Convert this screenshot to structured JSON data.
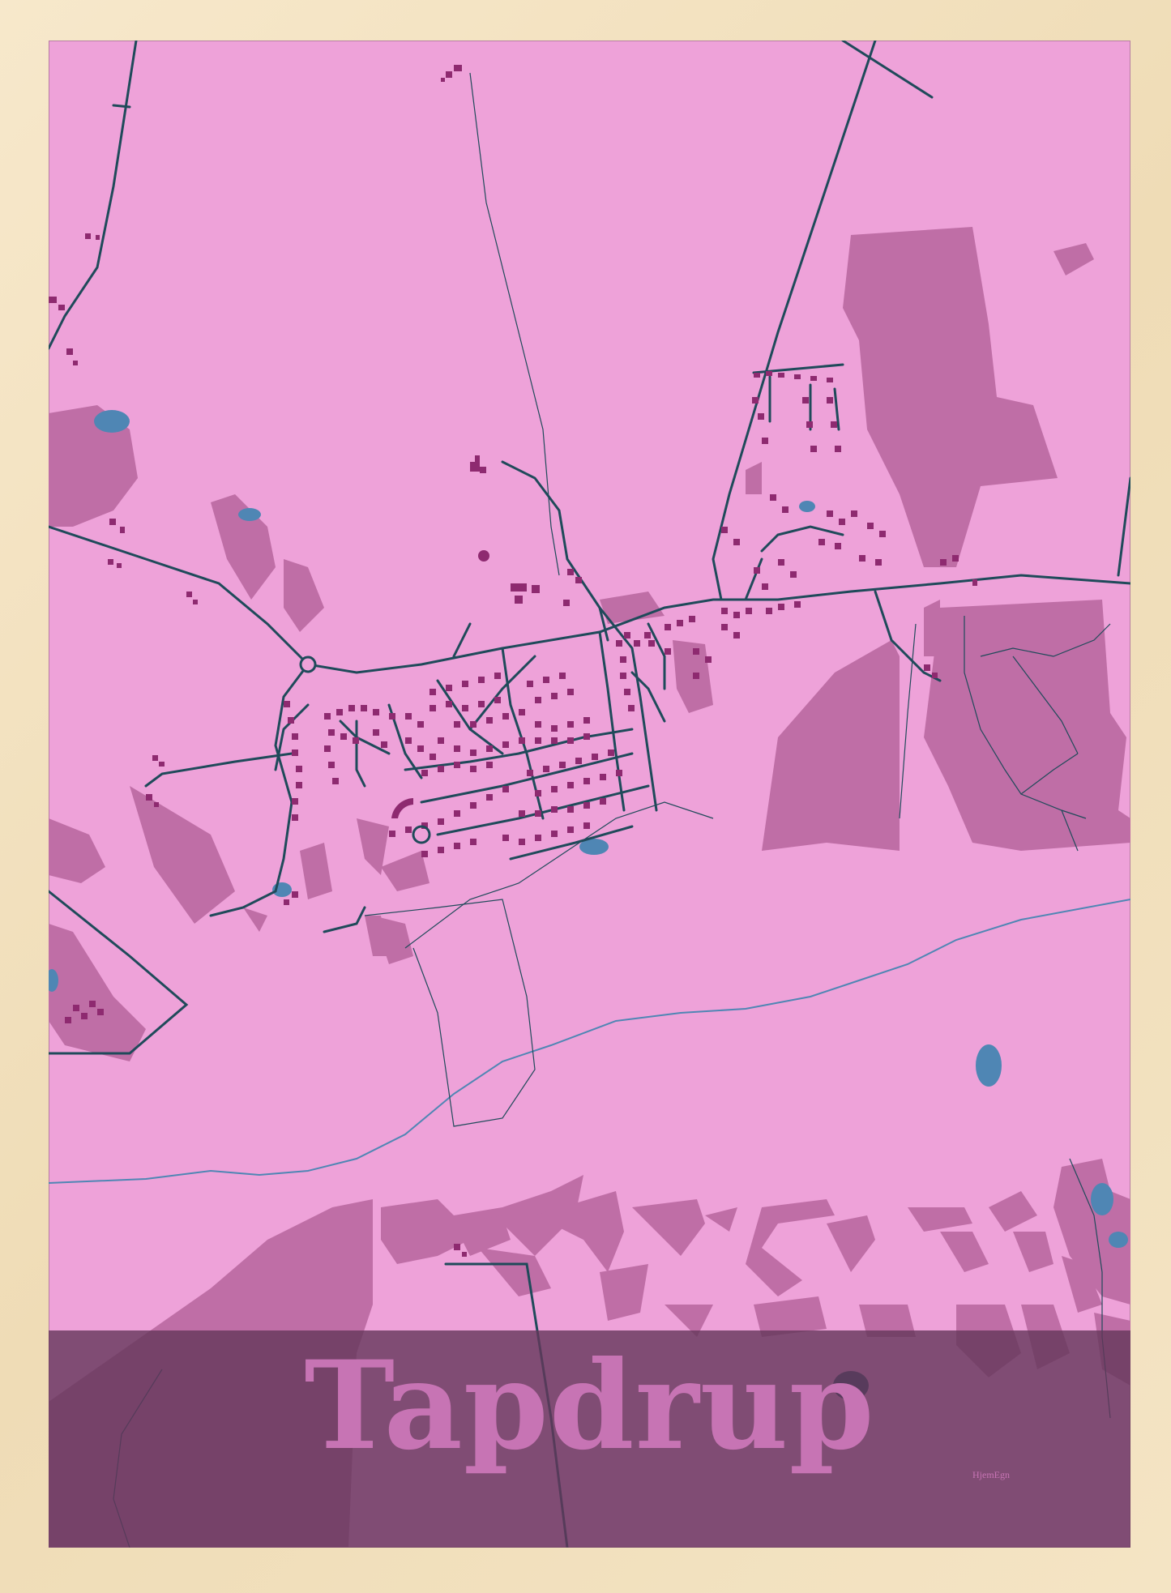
{
  "poster": {
    "place_name": "Tapdrup",
    "brand": "HjemEgn"
  },
  "colors": {
    "background": "#eea2d9",
    "land_patch": "#bf6ea6",
    "buildings": "#8e2a70",
    "roads": "#1f4a5a",
    "water": "#4f86b4",
    "banner": "#64375a",
    "frame": "#f3e3c2"
  }
}
